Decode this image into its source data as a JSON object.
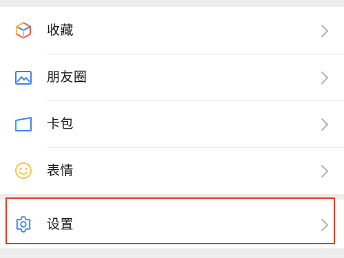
{
  "menu": {
    "items": [
      {
        "label": "收藏",
        "icon": "favorites-cube-icon"
      },
      {
        "label": "朋友圈",
        "icon": "moments-image-icon"
      },
      {
        "label": "卡包",
        "icon": "card-wallet-icon"
      },
      {
        "label": "表情",
        "icon": "smiley-icon"
      },
      {
        "label": "设置",
        "icon": "gear-icon"
      }
    ]
  },
  "colors": {
    "highlight_border": "#e8381f",
    "icon_blue": "#3d7ff5",
    "icon_yellow": "#f5c542",
    "icon_red": "#f05a4a",
    "background": "#ededed"
  }
}
